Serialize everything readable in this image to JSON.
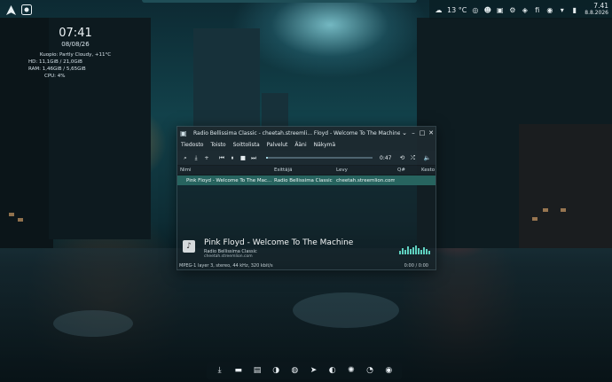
{
  "panel": {
    "launcher_icon": "arch-logo-icon",
    "app_icon": "audacious-icon",
    "weather": "13 °C",
    "tray_icons": [
      "weather-icon",
      "ring-icon",
      "cat-icon",
      "camera-icon",
      "settings-icon",
      "lock-icon",
      "fi-icon",
      "network-icon",
      "arrow-icon",
      "battery-icon"
    ],
    "tray_fi": "fi",
    "clock_time": "7.41",
    "clock_date": "8.8.2026"
  },
  "widget": {
    "time": "07:41",
    "date": "08/08/26",
    "weather": "Kuopio: Partly Cloudy, +11°C",
    "hd": "HD:  11,1GiB / 21,0GiB",
    "ram": "RAM:  1,46GiB / 5,65GiB",
    "cpu": "CPU: 4%"
  },
  "player": {
    "title": "Radio Bellissima Classic - cheetah.streemli... Floyd - Welcome To The Machine - Audacious",
    "menu": [
      "Tiedosto",
      "Toisto",
      "Soittolista",
      "Palvelut",
      "Ääni",
      "Näkymä"
    ],
    "elapsed": "0:47",
    "columns": [
      "Nimi",
      "Esittäjä",
      "Levy",
      "Q#",
      "Kesto"
    ],
    "rows": [
      {
        "name": "Pink Floyd - Welcome To The Mac...",
        "artist": "Radio Bellissima Classic",
        "album": "cheetah.streemlion.com",
        "queue": "",
        "length": ""
      }
    ],
    "now_playing": {
      "song": "Pink Floyd - Welcome To The Machine",
      "artist": "Radio Bellissima Classic",
      "url": "cheetah.streemlion.com",
      "format": "MPEG-1 layer 3, stereo, 44 kHz, 320 kbit/s",
      "position": "0:00 / 0:00"
    }
  },
  "dock": [
    "download-icon",
    "folder-icon",
    "terminal-icon",
    "audio-icon",
    "discord-icon",
    "telegram-icon",
    "steam-icon",
    "browser-icon",
    "music-icon",
    "audacious-icon"
  ],
  "colors": {
    "accent": "#27645f",
    "viz": "#5fd1c0"
  }
}
